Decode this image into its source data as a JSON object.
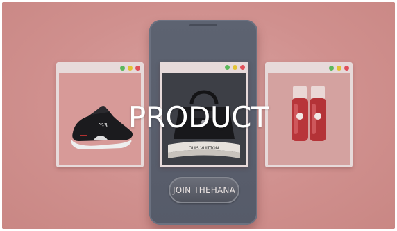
{
  "banner": {
    "title": "PRODUCT",
    "join_button_label": "JOIN THEHANA"
  },
  "windows": [
    {
      "product": "sneaker-image",
      "sneaker_logo_text": "Y-3"
    },
    {
      "product": "handbag-image",
      "bag_strap_text": "LOUIS VUITTON"
    },
    {
      "product": "lip-tint-bottles-image"
    }
  ],
  "colors": {
    "background": "#d09290",
    "phone": "#5b606e",
    "window_frame": "#e7dada",
    "dot_green": "#5cb85c",
    "dot_yellow": "#e2c233",
    "dot_red": "#e0505a",
    "title_text": "#ffffff"
  },
  "icons": {
    "window_controls": [
      "green-dot-icon",
      "yellow-dot-icon",
      "red-dot-icon"
    ]
  }
}
